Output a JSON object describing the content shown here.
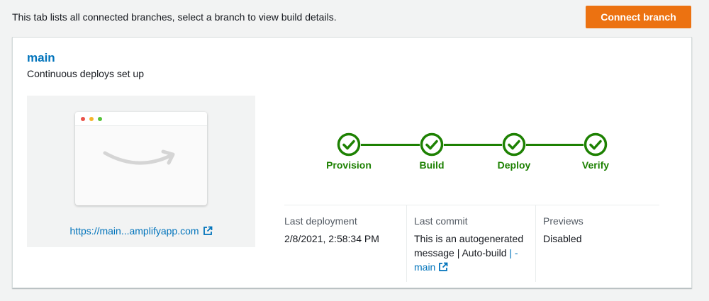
{
  "header": {
    "intro_text": "This tab lists all connected branches, select a branch to view build details.",
    "connect_label": "Connect branch"
  },
  "branch": {
    "name": "main",
    "status": "Continuous deploys set up",
    "preview_url": "https://main...amplifyapp.com"
  },
  "pipeline": {
    "stages": [
      "Provision",
      "Build",
      "Deploy",
      "Verify"
    ],
    "status_color": "#1d8102"
  },
  "details": {
    "last_deployment_label": "Last deployment",
    "last_deployment_value": "2/8/2021, 2:58:34 PM",
    "last_commit_label": "Last commit",
    "last_commit_line1": "This is an autogenerated",
    "last_commit_line2": "message | Auto-build",
    "last_commit_sep": "|",
    "last_commit_dash": "-",
    "last_commit_branch": "main",
    "previews_label": "Previews",
    "previews_value": "Disabled"
  },
  "colors": {
    "accent": "#ec7211",
    "link": "#0073bb",
    "success": "#1d8102"
  }
}
